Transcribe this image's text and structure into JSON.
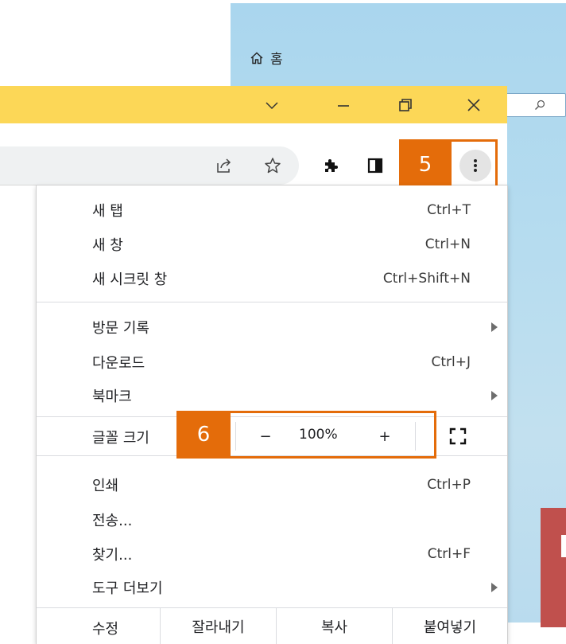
{
  "background_window": {
    "home_label": "홈",
    "colors": {
      "sky": "#b6dcef",
      "red_panel": "#c0504d"
    }
  },
  "titlebar": {
    "color": "#fcd757",
    "buttons": [
      "chevron-down-icon",
      "minimize-icon",
      "restore-icon",
      "close-icon"
    ]
  },
  "toolbar": {
    "icons": [
      "share-icon",
      "star-icon",
      "extensions-icon",
      "side-panel-icon",
      "more-vert-icon"
    ]
  },
  "callouts": {
    "menu_button_label": "5",
    "zoom_label": "6",
    "color": "#e46c0a"
  },
  "menu": {
    "items": [
      {
        "label": "새 탭",
        "shortcut": "Ctrl+T"
      },
      {
        "label": "새 창",
        "shortcut": "Ctrl+N"
      },
      {
        "label": "새 시크릿 창",
        "shortcut": "Ctrl+Shift+N"
      },
      {
        "label": "방문 기록",
        "shortcut": ""
      },
      {
        "label": "다운로드",
        "shortcut": "Ctrl+J"
      },
      {
        "label": "북마크",
        "shortcut": ""
      },
      {
        "label": "인쇄",
        "shortcut": "Ctrl+P"
      },
      {
        "label": "전송...",
        "shortcut": ""
      },
      {
        "label": "찾기...",
        "shortcut": "Ctrl+F"
      },
      {
        "label": "도구 더보기",
        "shortcut": ""
      }
    ],
    "zoom": {
      "label": "글꼴 크기",
      "minus": "−",
      "value": "100%",
      "plus": "+"
    },
    "edit": {
      "label": "수정",
      "cut": "잘라내기",
      "copy": "복사",
      "paste": "붙여넣기"
    }
  }
}
